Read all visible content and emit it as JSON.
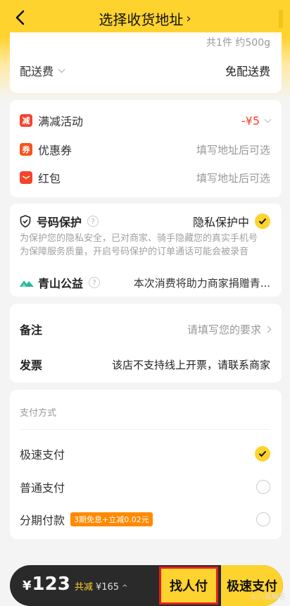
{
  "header": {
    "title": "选择收货地址",
    "title_chevron": "›"
  },
  "summary": {
    "weight_text": "共1件 约500g",
    "delivery_label": "配送费",
    "delivery_value": "免配送费"
  },
  "promotions": [
    {
      "icon": "减",
      "label": "满减活动",
      "value": "-¥5",
      "icon_color": "#f5432f"
    },
    {
      "icon": "券",
      "label": "优惠券",
      "value": "填写地址后可选",
      "icon_color": "#f5531e"
    },
    {
      "icon": "",
      "label": "红包",
      "value": "填写地址后可选",
      "icon_color": "#f5432f"
    }
  ],
  "privacy": {
    "title": "号码保护",
    "status": "隐私保护中",
    "desc_line1": "为保护您的隐私安全，已对商家、骑手隐藏您的真实手机号",
    "desc_line2": "为保障服务质量，开启号码保护的订单通话可能会被录音",
    "qmark": "?"
  },
  "charity": {
    "title": "青山公益",
    "value": "本次消费将助力商家捐赠青..."
  },
  "order_notes": {
    "note_label": "备注",
    "note_value": "请填写您的要求",
    "invoice_label": "发票",
    "invoice_value": "该店不支持线上开票，请联系商家"
  },
  "payment": {
    "title": "支付方式",
    "options": [
      {
        "label": "极速支付",
        "selected": true
      },
      {
        "label": "普通支付",
        "selected": false
      },
      {
        "label": "分期付款",
        "selected": false,
        "tag": "3期免息+立减0.02元"
      }
    ]
  },
  "bottom_bar": {
    "currency": "¥",
    "total": "123",
    "saved_label": "共减",
    "saved_value": "¥165",
    "expand_icon": "^",
    "find_pay_label": "找人付",
    "fast_pay_label": "极速支付"
  },
  "watermark": "©八戒解答",
  "colors": {
    "accent_yellow": "#ffd32e",
    "promo_red": "#f5432f",
    "highlight_border": "#e02020"
  }
}
